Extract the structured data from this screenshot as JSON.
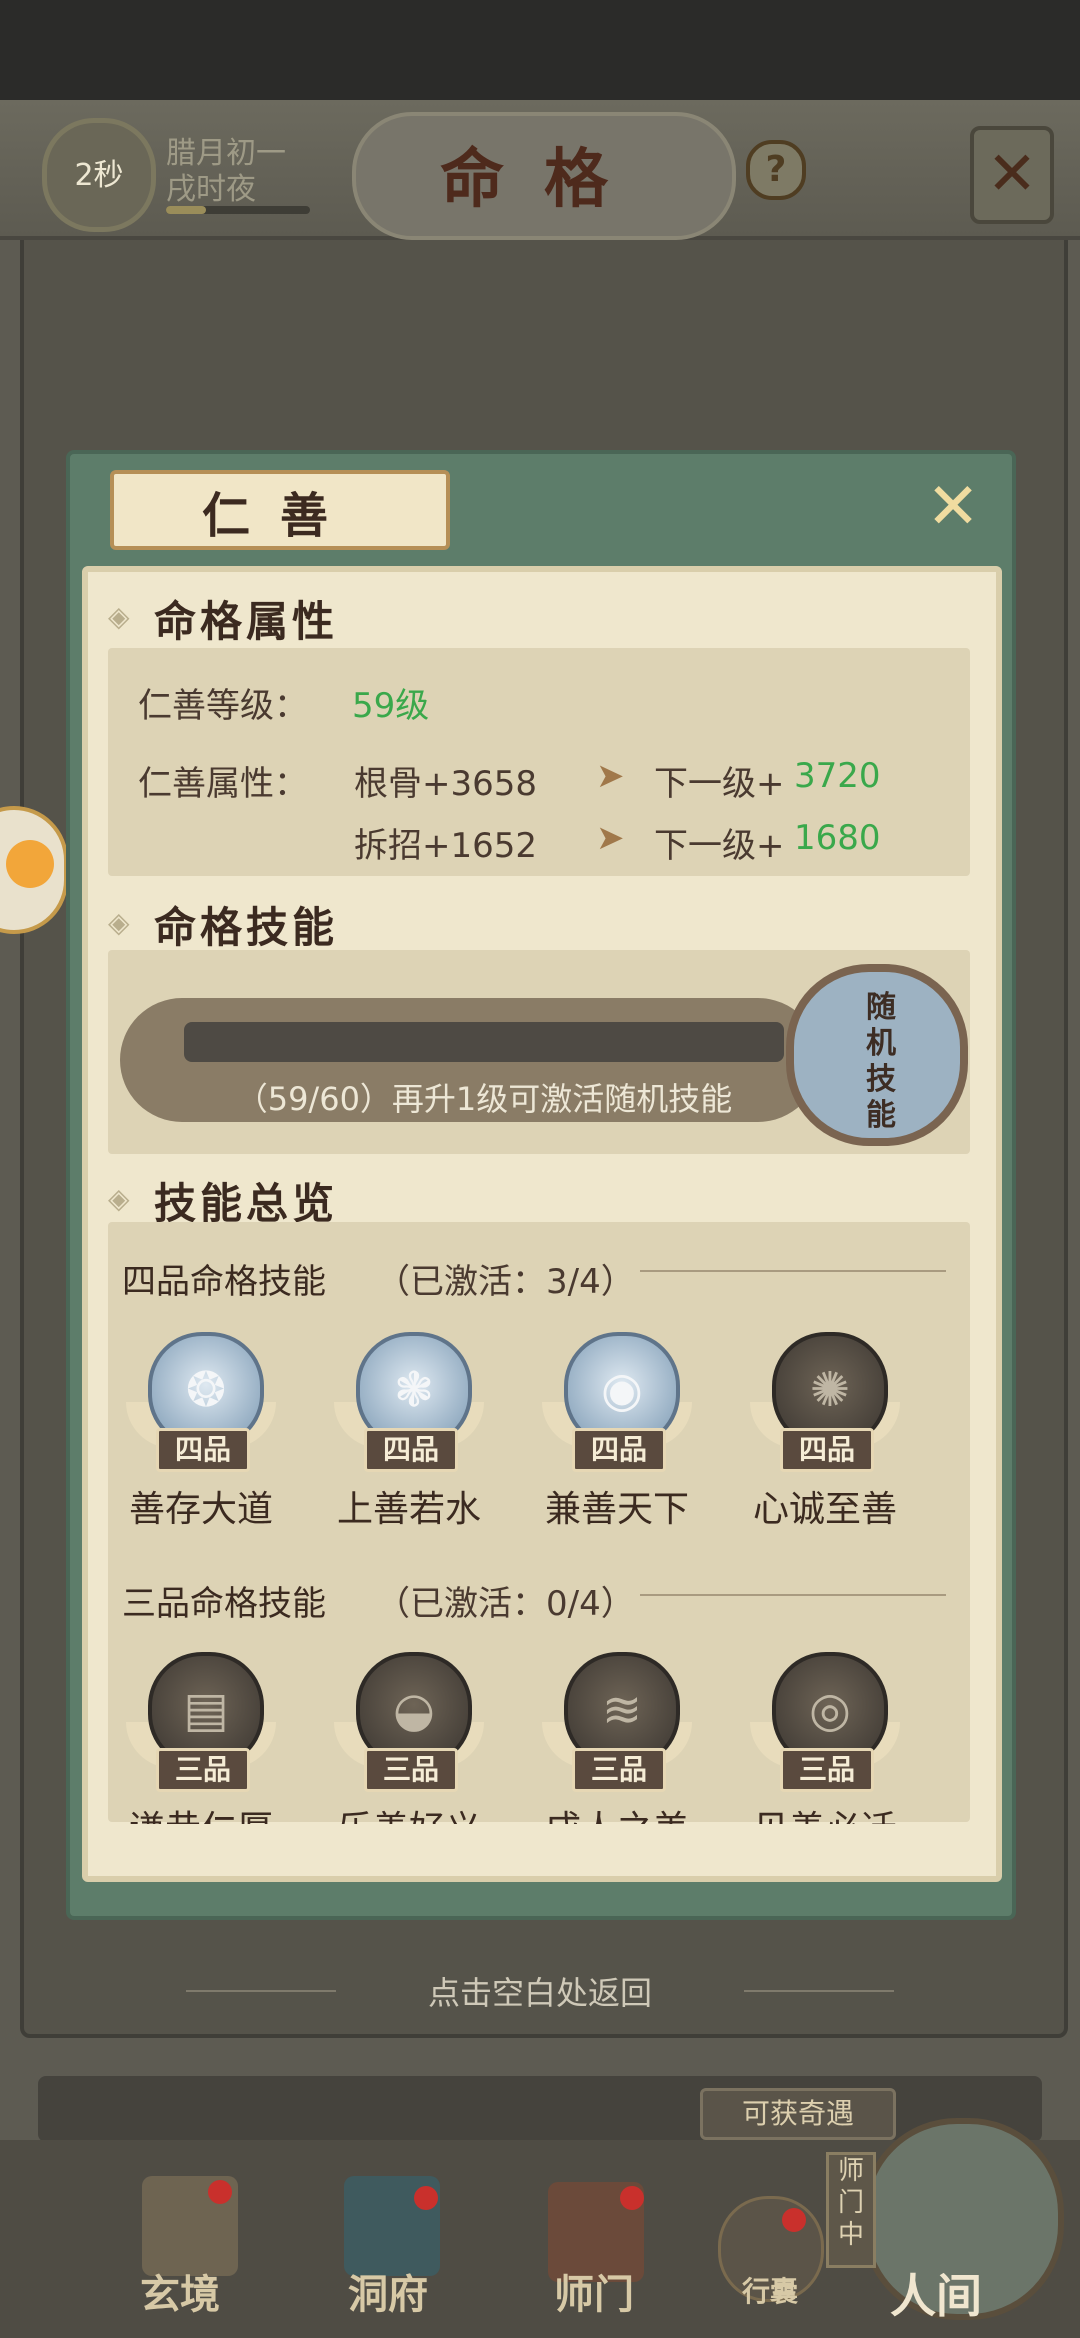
{
  "header": {
    "timer": "2秒",
    "date_line1": "腊月初一",
    "date_line2": "戌时夜",
    "title": "命格",
    "help_symbol": "?",
    "close_symbol": "✕"
  },
  "panel": {
    "title": "仁善",
    "close_symbol": "✕",
    "attributes": {
      "heading": "命格属性",
      "level_label": "仁善等级：",
      "level_value": "59级",
      "attr_label": "仁善属性：",
      "rows": [
        {
          "stat": "根骨+3658",
          "next_label": "下一级+",
          "next_value": "3720"
        },
        {
          "stat": "拆招+1652",
          "next_label": "下一级+",
          "next_value": "1680"
        }
      ]
    },
    "skill": {
      "heading": "命格技能",
      "progress_text": "（59/60）再升1级可激活随机技能",
      "progress_fraction": 0,
      "emblem_text": "随机技能"
    },
    "overview": {
      "heading": "技能总览",
      "tier4": {
        "title": "四品命格技能",
        "activated": "（已激活：3/4）",
        "grade": "四品",
        "skills": [
          {
            "name": "善存大道",
            "glyph": "❂",
            "active": true
          },
          {
            "name": "上善若水",
            "glyph": "❃",
            "active": true
          },
          {
            "name": "兼善天下",
            "glyph": "◉",
            "active": true
          },
          {
            "name": "心诚至善",
            "glyph": "✺",
            "active": false
          }
        ]
      },
      "tier3": {
        "title": "三品命格技能",
        "activated": "（已激活：0/4）",
        "grade": "三品",
        "skills": [
          {
            "name": "谦恭仁厚",
            "glyph": "▤",
            "active": false
          },
          {
            "name": "乐善好义",
            "glyph": "◒",
            "active": false
          },
          {
            "name": "成人之美",
            "glyph": "≋",
            "active": false
          },
          {
            "name": "见善必迁",
            "glyph": "◎",
            "active": false
          }
        ]
      }
    }
  },
  "tap_return": "点击空白处返回",
  "bottom_nav": {
    "obtainable": "可获奇遇",
    "sect_tag": "师门中",
    "items": [
      {
        "label": "玄境"
      },
      {
        "label": "洞府"
      },
      {
        "label": "师门"
      },
      {
        "label": "行囊"
      },
      {
        "label": "人间"
      }
    ]
  },
  "colors": {
    "accent_green": "#3aa84b",
    "panel_green": "#5d7d6a",
    "parchment": "#efe7cd",
    "brown_text": "#3b2a20"
  }
}
